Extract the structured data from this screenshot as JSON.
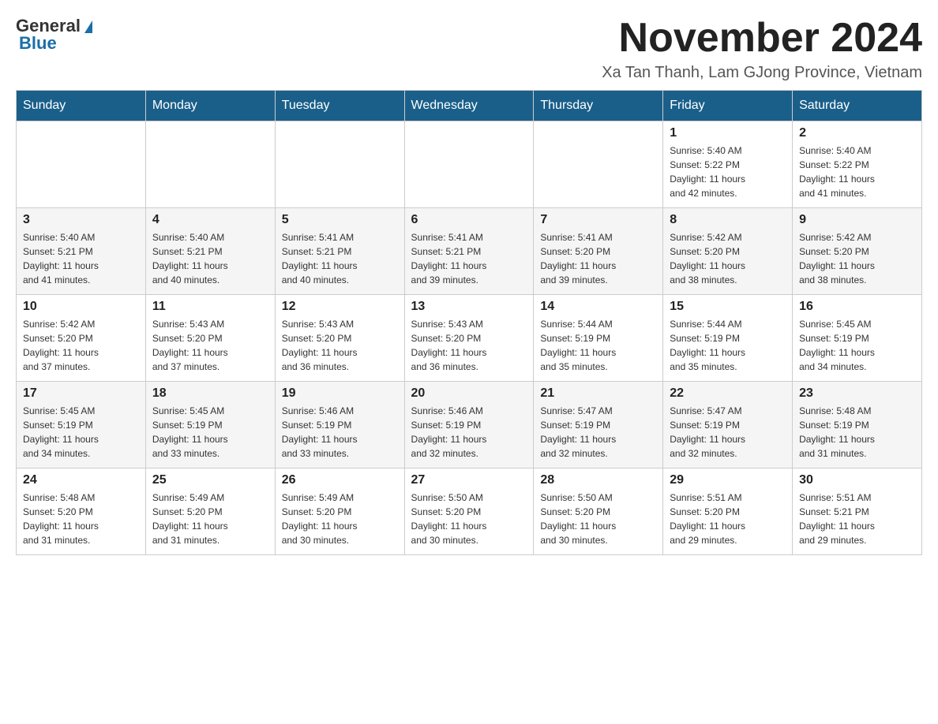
{
  "logo": {
    "text_general": "General",
    "text_blue": "Blue"
  },
  "header": {
    "month_title": "November 2024",
    "location": "Xa Tan Thanh, Lam GJong Province, Vietnam"
  },
  "days_of_week": [
    "Sunday",
    "Monday",
    "Tuesday",
    "Wednesday",
    "Thursday",
    "Friday",
    "Saturday"
  ],
  "weeks": [
    [
      {
        "day": "",
        "info": ""
      },
      {
        "day": "",
        "info": ""
      },
      {
        "day": "",
        "info": ""
      },
      {
        "day": "",
        "info": ""
      },
      {
        "day": "",
        "info": ""
      },
      {
        "day": "1",
        "info": "Sunrise: 5:40 AM\nSunset: 5:22 PM\nDaylight: 11 hours\nand 42 minutes."
      },
      {
        "day": "2",
        "info": "Sunrise: 5:40 AM\nSunset: 5:22 PM\nDaylight: 11 hours\nand 41 minutes."
      }
    ],
    [
      {
        "day": "3",
        "info": "Sunrise: 5:40 AM\nSunset: 5:21 PM\nDaylight: 11 hours\nand 41 minutes."
      },
      {
        "day": "4",
        "info": "Sunrise: 5:40 AM\nSunset: 5:21 PM\nDaylight: 11 hours\nand 40 minutes."
      },
      {
        "day": "5",
        "info": "Sunrise: 5:41 AM\nSunset: 5:21 PM\nDaylight: 11 hours\nand 40 minutes."
      },
      {
        "day": "6",
        "info": "Sunrise: 5:41 AM\nSunset: 5:21 PM\nDaylight: 11 hours\nand 39 minutes."
      },
      {
        "day": "7",
        "info": "Sunrise: 5:41 AM\nSunset: 5:20 PM\nDaylight: 11 hours\nand 39 minutes."
      },
      {
        "day": "8",
        "info": "Sunrise: 5:42 AM\nSunset: 5:20 PM\nDaylight: 11 hours\nand 38 minutes."
      },
      {
        "day": "9",
        "info": "Sunrise: 5:42 AM\nSunset: 5:20 PM\nDaylight: 11 hours\nand 38 minutes."
      }
    ],
    [
      {
        "day": "10",
        "info": "Sunrise: 5:42 AM\nSunset: 5:20 PM\nDaylight: 11 hours\nand 37 minutes."
      },
      {
        "day": "11",
        "info": "Sunrise: 5:43 AM\nSunset: 5:20 PM\nDaylight: 11 hours\nand 37 minutes."
      },
      {
        "day": "12",
        "info": "Sunrise: 5:43 AM\nSunset: 5:20 PM\nDaylight: 11 hours\nand 36 minutes."
      },
      {
        "day": "13",
        "info": "Sunrise: 5:43 AM\nSunset: 5:20 PM\nDaylight: 11 hours\nand 36 minutes."
      },
      {
        "day": "14",
        "info": "Sunrise: 5:44 AM\nSunset: 5:19 PM\nDaylight: 11 hours\nand 35 minutes."
      },
      {
        "day": "15",
        "info": "Sunrise: 5:44 AM\nSunset: 5:19 PM\nDaylight: 11 hours\nand 35 minutes."
      },
      {
        "day": "16",
        "info": "Sunrise: 5:45 AM\nSunset: 5:19 PM\nDaylight: 11 hours\nand 34 minutes."
      }
    ],
    [
      {
        "day": "17",
        "info": "Sunrise: 5:45 AM\nSunset: 5:19 PM\nDaylight: 11 hours\nand 34 minutes."
      },
      {
        "day": "18",
        "info": "Sunrise: 5:45 AM\nSunset: 5:19 PM\nDaylight: 11 hours\nand 33 minutes."
      },
      {
        "day": "19",
        "info": "Sunrise: 5:46 AM\nSunset: 5:19 PM\nDaylight: 11 hours\nand 33 minutes."
      },
      {
        "day": "20",
        "info": "Sunrise: 5:46 AM\nSunset: 5:19 PM\nDaylight: 11 hours\nand 32 minutes."
      },
      {
        "day": "21",
        "info": "Sunrise: 5:47 AM\nSunset: 5:19 PM\nDaylight: 11 hours\nand 32 minutes."
      },
      {
        "day": "22",
        "info": "Sunrise: 5:47 AM\nSunset: 5:19 PM\nDaylight: 11 hours\nand 32 minutes."
      },
      {
        "day": "23",
        "info": "Sunrise: 5:48 AM\nSunset: 5:19 PM\nDaylight: 11 hours\nand 31 minutes."
      }
    ],
    [
      {
        "day": "24",
        "info": "Sunrise: 5:48 AM\nSunset: 5:20 PM\nDaylight: 11 hours\nand 31 minutes."
      },
      {
        "day": "25",
        "info": "Sunrise: 5:49 AM\nSunset: 5:20 PM\nDaylight: 11 hours\nand 31 minutes."
      },
      {
        "day": "26",
        "info": "Sunrise: 5:49 AM\nSunset: 5:20 PM\nDaylight: 11 hours\nand 30 minutes."
      },
      {
        "day": "27",
        "info": "Sunrise: 5:50 AM\nSunset: 5:20 PM\nDaylight: 11 hours\nand 30 minutes."
      },
      {
        "day": "28",
        "info": "Sunrise: 5:50 AM\nSunset: 5:20 PM\nDaylight: 11 hours\nand 30 minutes."
      },
      {
        "day": "29",
        "info": "Sunrise: 5:51 AM\nSunset: 5:20 PM\nDaylight: 11 hours\nand 29 minutes."
      },
      {
        "day": "30",
        "info": "Sunrise: 5:51 AM\nSunset: 5:21 PM\nDaylight: 11 hours\nand 29 minutes."
      }
    ]
  ]
}
